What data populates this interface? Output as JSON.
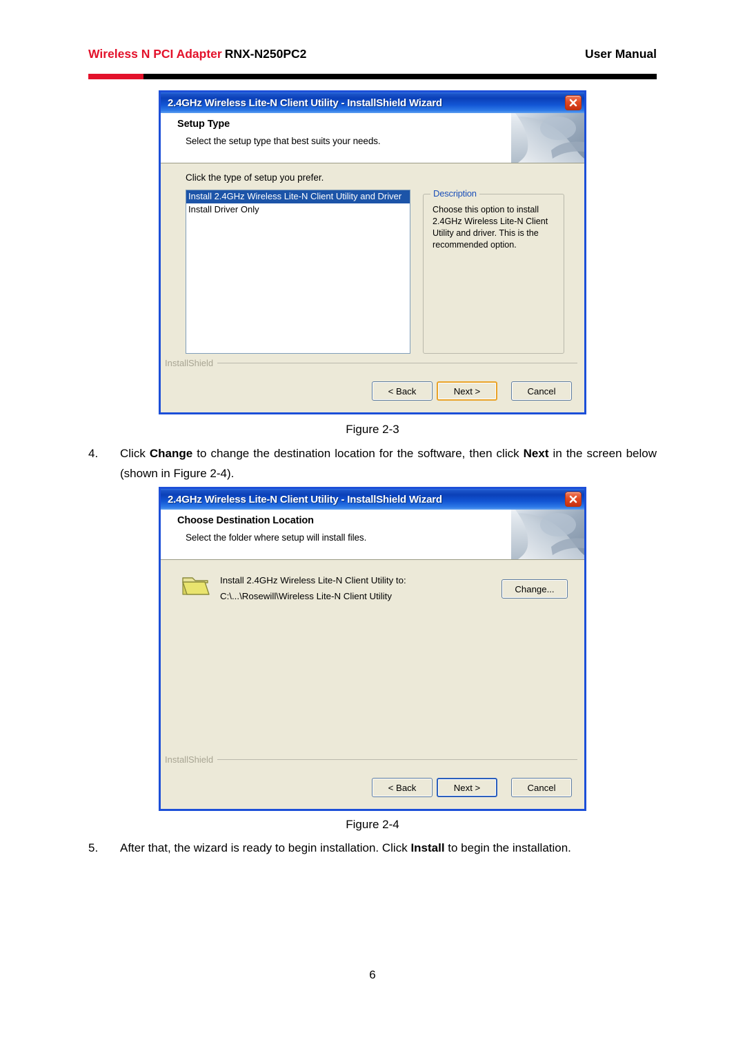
{
  "header": {
    "brand": "Wireless N PCI Adapter",
    "model": "RNX-N250PC2",
    "doc_type": "User Manual",
    "accent_red": "#e3122b",
    "rule_black": "#000000"
  },
  "dialogs": {
    "setup_type": {
      "titlebar": "2.4GHz Wireless Lite-N Client Utility - InstallShield Wizard",
      "close_label": "Close",
      "banner_title": "Setup Type",
      "banner_subtitle": "Select the setup type that best suits your needs.",
      "prompt": "Click the type of setup you prefer.",
      "list_items": [
        "Install 2.4GHz Wireless Lite-N Client Utility and Driver",
        "Install Driver Only"
      ],
      "selected_index": 0,
      "description_legend": "Description",
      "description_text": "Choose this option to install 2.4GHz Wireless Lite-N Client Utility and driver. This is the recommended option.",
      "installshield_label": "InstallShield",
      "buttons": {
        "back": "< Back",
        "next": "Next >",
        "cancel": "Cancel"
      },
      "focused_button": "next",
      "focus_color": "#e9a227",
      "selection_color": "#1c54a8",
      "legend_color": "#1b4fb8",
      "body_color": "#ece9d8",
      "frame_color": "#1c4fd8"
    },
    "destination": {
      "titlebar": "2.4GHz Wireless Lite-N Client Utility - InstallShield Wizard",
      "close_label": "Close",
      "banner_title": "Choose Destination Location",
      "banner_subtitle": "Select the folder where setup will install files.",
      "install_to_label": "Install 2.4GHz Wireless Lite-N Client Utility to:",
      "install_path": "C:\\...\\Rosewill\\Wireless Lite-N Client Utility",
      "change_button": "Change...",
      "folder_icon": "folder-icon",
      "installshield_label": "InstallShield",
      "buttons": {
        "back": "< Back",
        "next": "Next >",
        "cancel": "Cancel"
      },
      "focused_button": "next",
      "focus_color": "#2b5fbd",
      "body_color": "#ece9d8",
      "frame_color": "#1c4fd8"
    }
  },
  "figures": {
    "caption_1": "Figure 2-3",
    "caption_2": "Figure 2-4"
  },
  "steps": {
    "step4": {
      "number": "4.",
      "part1": "Click ",
      "bold1": "Change",
      "part2": " to change the destination location for the software, then click ",
      "bold2": "Next",
      "part3": " in the screen below (shown in Figure 2-4)."
    },
    "step5": {
      "number": "5.",
      "part1": "After that, the wizard is ready to begin installation. Click ",
      "bold1": "Install",
      "part2": " to begin the installation."
    }
  },
  "page_number": "6"
}
